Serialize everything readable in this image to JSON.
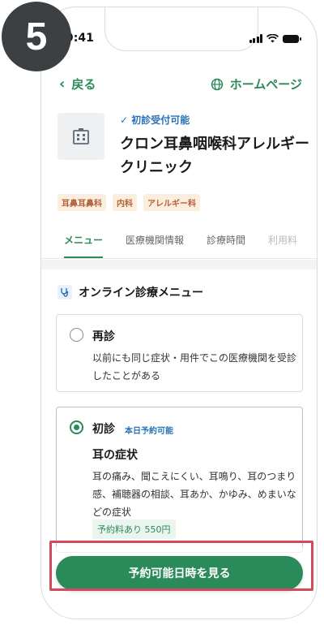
{
  "step": "5",
  "status_bar": {
    "time": "9:41"
  },
  "nav": {
    "back_label": "戻る",
    "home_label": "ホームページ"
  },
  "clinic": {
    "first_visit_status": "初診受付可能",
    "name": "クロン耳鼻咽喉科アレルギークリニック",
    "tags": [
      "耳鼻耳鼻科",
      "内科",
      "アレルギー科"
    ]
  },
  "tabs": [
    "メニュー",
    "医療機関情報",
    "診療時間",
    "利用料"
  ],
  "menu": {
    "section_title": "オンライン診療メニュー",
    "revisit": {
      "title": "再診",
      "description": "以前にも同じ症状・用件でこの医療機関を受診したことがある"
    },
    "first": {
      "title": "初診",
      "badge": "本日予約可能",
      "symptom": "耳の症状",
      "description": "耳の痛み、聞こえにくい、耳鳴り、耳のつまり感、補聴器の相談、耳あか、かゆみ、めまいなどの症状",
      "fee": "予約料あり 550円"
    }
  },
  "cta_label": "予約可能日時を見る",
  "colors": {
    "accent": "#2a8a5a",
    "link_blue": "#2a72b8",
    "highlight": "#d24a5c"
  }
}
